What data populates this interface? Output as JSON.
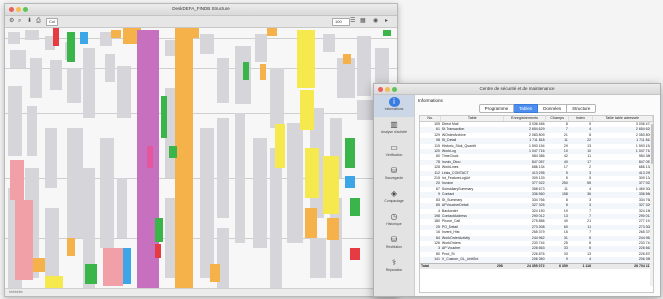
{
  "back_window": {
    "title": "DeskDEFA_FINDB Structure",
    "toolbar_selector": "Col",
    "zoom_field": "100",
    "statusbar_left": "bbbbbbb"
  },
  "front_window": {
    "title": "Centre de sécurité et de maintenance",
    "section_title": "Informations",
    "tabs": [
      {
        "label": "Programme",
        "active": false
      },
      {
        "label": "Tables",
        "active": true
      },
      {
        "label": "Données",
        "active": false
      },
      {
        "label": "Structure",
        "active": false
      }
    ],
    "sidebar": [
      {
        "label": "Informations",
        "icon": "info-icon",
        "active": true
      },
      {
        "label": "Analyse d'activité",
        "icon": "analysis-icon",
        "active": false
      },
      {
        "label": "Vérification",
        "icon": "verification-icon",
        "active": false
      },
      {
        "label": "Sauvegarde",
        "icon": "backup-icon",
        "active": false
      },
      {
        "label": "Compactage",
        "icon": "compact-icon",
        "active": false
      },
      {
        "label": "Historique",
        "icon": "history-icon",
        "active": false
      },
      {
        "label": "Restitution",
        "icon": "restore-icon",
        "active": false
      },
      {
        "label": "Réparation",
        "icon": "repair-icon",
        "active": false
      }
    ],
    "table": {
      "columns": [
        "No.",
        "Table",
        "Enregistrements",
        "Champs",
        "Index",
        "Taille table adressée"
      ],
      "rows": [
        [
          "105",
          "Direct Mail",
          "3 036 466",
          "8",
          "5",
          "3 036 472"
        ],
        [
          "61",
          "St.Transaction",
          "2 654 629",
          "7",
          "4",
          "2 654 629"
        ],
        [
          "129",
          "WOrderArchive",
          "2 083 809",
          "21",
          "8",
          "2 083 809"
        ],
        [
          "98",
          "St_Detail",
          "1 711 818",
          "11",
          "22",
          "1 711 818"
        ],
        [
          "115",
          "Historic_Stok_Quantit",
          "1 593 154",
          "29",
          "13",
          "1 593 154"
        ],
        [
          "120",
          "WorkLog",
          "1 047 716",
          "10",
          "10",
          "1 047 716"
        ],
        [
          "60",
          "TimeClock",
          "984 386",
          "42",
          "11",
          "984 386"
        ],
        [
          "78",
          "Invoic_Dtou",
          "847 057",
          "40",
          "17",
          "847 057"
        ],
        [
          "128",
          "WorkLines",
          "686 134",
          "17",
          "2",
          "686 134"
        ],
        [
          "112",
          "Links_CONTACT",
          "413 295",
          "5",
          "3",
          "413 295"
        ],
        [
          "215",
          "Int_FeatureLogUrl",
          "309 133",
          "5",
          "5",
          "309 134"
        ],
        [
          "20",
          "Invoice",
          "377 922",
          "250",
          "55",
          "377 922"
        ],
        [
          "67",
          "SubsidiarySummary",
          "358 673",
          "11",
          "4",
          "1 469 308"
        ],
        [
          "9",
          "Contact",
          "336 560",
          "158",
          "36",
          "336 560"
        ],
        [
          "83",
          "St_Summary",
          "334 766",
          "8",
          "3",
          "334 768"
        ],
        [
          "85",
          "APVoucherDetail",
          "327 325",
          "5",
          "3",
          "327 329"
        ],
        [
          "4",
          "Backorder",
          "324 150",
          "19",
          "7",
          "324 150"
        ],
        [
          "198",
          "ContactAddress",
          "290 012",
          "13",
          "7",
          "290 012"
        ],
        [
          "180",
          "Phone_Call",
          "275 886",
          "40",
          "21",
          "277 191"
        ],
        [
          "25",
          "PO_Detail",
          "273 308",
          "60",
          "11",
          "273 308"
        ],
        [
          "16",
          "Invent_Hist",
          "265 379",
          "15",
          "7",
          "265 379"
        ],
        [
          "84",
          "WorkOrderActivity",
          "244 962",
          "31",
          "5",
          "244 962"
        ],
        [
          "126",
          "WorkOrders",
          "233 744",
          "25",
          "8",
          "233 744"
        ],
        [
          "3",
          "AP Voucher",
          "226 663",
          "33",
          "5",
          "226 663"
        ],
        [
          "80",
          "Prod_St",
          "226 876",
          "33",
          "13",
          "226 876"
        ],
        [
          "141",
          "X_Custom_GL_UnitSnt",
          "206 350",
          "9",
          "4",
          "206 350"
        ]
      ],
      "total": [
        "Total",
        "298",
        "24 355 072",
        "6 359",
        "1 116",
        "26 704 117"
      ]
    }
  },
  "colors": {
    "accent": "#4c8df0",
    "structure_orange": "#f5b24a",
    "structure_purple": "#c770c0",
    "structure_yellow": "#f5e94e",
    "structure_green": "#3ab54a"
  }
}
